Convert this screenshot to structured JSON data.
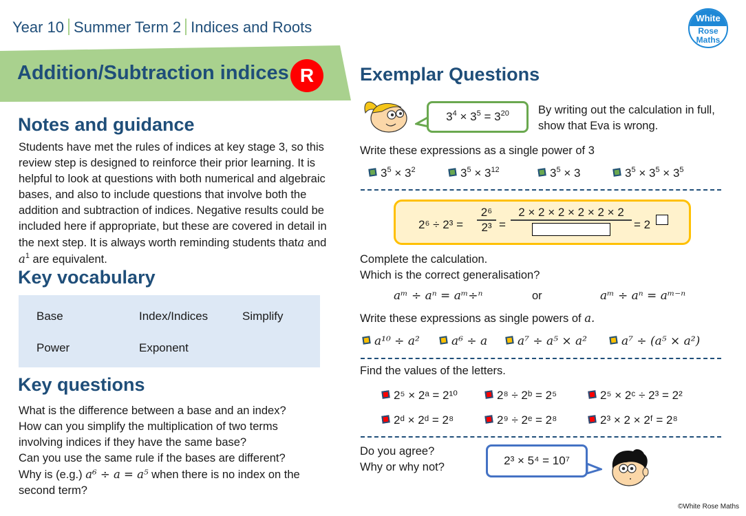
{
  "header": {
    "year": "Year 10",
    "term": "Summer Term 2",
    "unit": "Indices and Roots",
    "step_title": "Addition/Subtraction indices",
    "badge": "R",
    "logo": {
      "line1": "White",
      "line2": "Rose",
      "line3": "Maths"
    }
  },
  "colors": {
    "navy": "#1f4e79",
    "banner_green": "#a9d18e",
    "badge_red": "#ff0000",
    "vocab_bg": "#dde8f5",
    "calc_box_border": "#ffc000",
    "calc_box_fill": "#fff2cc"
  },
  "notes": {
    "heading": "Notes and guidance",
    "lines": [
      "Students have met the rules of indices at key stage 3, so this",
      "review step is designed to reinforce their prior learning. It is",
      "helpful to look at questions with both numerical and algebraic",
      "bases, and also to include questions that involve both the",
      "addition and subtraction of indices. Negative results could be",
      "included here if appropriate, but these are covered in detail in",
      "the next step. It is always worth reminding students that"
    ],
    "line7_var": "a",
    "line7_end": " and",
    "line8_var": "a",
    "line8_sup": "1",
    "line8_end": " are equivalent."
  },
  "vocabulary": {
    "heading": "Key vocabulary",
    "words": [
      "Base",
      "Index/Indices",
      "Simplify",
      "Power",
      "Exponent"
    ]
  },
  "key_questions": {
    "heading": "Key questions",
    "lines": [
      "What is the difference between a base and an index?",
      "How can you simplify the multiplication of two terms",
      "involving indices if they have the same base?",
      "Can you use the same rule if the bases are different?"
    ],
    "q5_start": "Why is (e.g.) ",
    "q5_math": "a⁶ ÷ a = a⁵",
    "q5_end": " when there is no index on the",
    "q5_line2": "second term?"
  },
  "exemplar": {
    "heading": "Exemplar Questions",
    "q1": {
      "bubble": {
        "b1": "3",
        "e1": "4",
        "b2": "3",
        "e2": "5",
        "b3": "3",
        "e3": "20"
      },
      "prompt_line1": "By writing out the calculation in full,",
      "prompt_line2": "show that Eva is wrong."
    },
    "q2": {
      "prompt": "Write these expressions as a single power of 3",
      "items": [
        {
          "parts": [
            [
              "3",
              "5"
            ],
            [
              "3",
              "2"
            ]
          ]
        },
        {
          "parts": [
            [
              "3",
              "5"
            ],
            [
              "3",
              "12"
            ]
          ]
        },
        {
          "parts": [
            [
              "3",
              "5"
            ],
            [
              "3",
              ""
            ]
          ]
        },
        {
          "parts": [
            [
              "3",
              "5"
            ],
            [
              "3",
              "5"
            ],
            [
              "3",
              "5"
            ]
          ]
        }
      ]
    },
    "q3": {
      "lhs": "2⁶ ÷ 2³ =",
      "frac1_num": "2⁶",
      "frac1_den": "2³",
      "frac2_num": "2 × 2 × 2 × 2 × 2 × 2",
      "result": "= 2",
      "prompt_line1": "Complete the calculation.",
      "prompt_line2": "Which is the correct generalisation?",
      "option1": "aᵐ ÷ aⁿ = aᵐ÷ⁿ",
      "or": "or",
      "option2": "aᵐ ÷ aⁿ = aᵐ⁻ⁿ"
    },
    "q4": {
      "prompt": "Write these expressions as single powers of",
      "prompt_var": "a.",
      "items": [
        "a¹⁰ ÷ a²",
        "a⁶ ÷ a",
        "a⁷ ÷ a⁵ × a²",
        "a⁷ ÷ (a⁵ × a²)"
      ]
    },
    "q5": {
      "prompt": "Find the values of the letters.",
      "items": [
        "2⁵ × 2ᵃ = 2¹⁰",
        "2⁸ ÷ 2ᵇ = 2⁵",
        "2⁵ × 2ᶜ ÷ 2³ = 2²",
        "2ᵈ × 2ᵈ = 2⁸",
        "2⁹ ÷ 2ᵉ = 2⁸",
        "2³ × 2 × 2ᶠ = 2⁸"
      ]
    },
    "q6": {
      "prompt_line1": "Do you agree?",
      "prompt_line2": "Why or why not?",
      "bubble": "2³ × 5⁴ = 10⁷"
    }
  },
  "footer": {
    "copyright": "©White Rose Maths"
  }
}
